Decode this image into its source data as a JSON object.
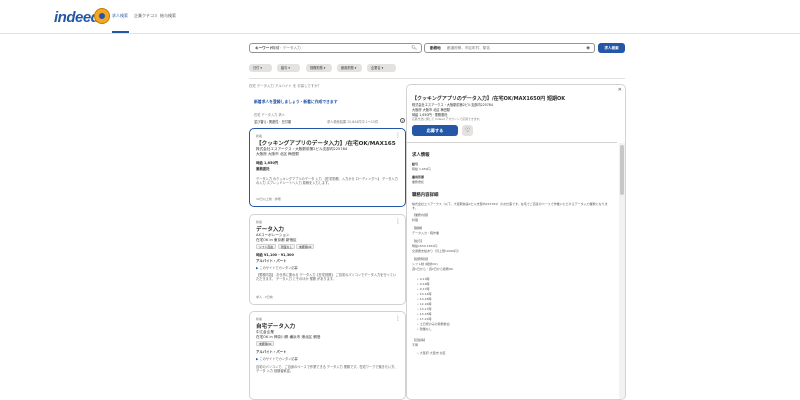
{
  "header": {
    "logo": "indeed",
    "nav": [
      "求人検索",
      "企業クチコミ",
      "給与検索"
    ]
  },
  "search": {
    "what_label": "キーワード",
    "what_placeholder": "職種・データ入力",
    "where_label": "勤務地",
    "where_placeholder": "都道府県、市区町村、駅名",
    "button": "求人検索"
  },
  "filters": [
    "日付",
    "給与",
    "勤務形態",
    "雇用形態",
    "企業名"
  ],
  "results": {
    "prompt": "在宅 データ入力 アルバイト を お探しですか？",
    "alert": "新着求人を登録しましょう・新着に作成できます",
    "meta": "在宅 データ入力 求人",
    "sort": "並び替え: 関連性 · 日付順",
    "count": "求人検索結果 25,844件中 1〜15件"
  },
  "cards": [
    {
      "new": "新着",
      "title": "【クッキングアプリのデータ入力】/在宅OK/MAX1650円 短...",
      "company": "株式会社エスアークス・大阪駅前第2ビル支部内225784",
      "location": "大阪府 大阪市 北区 梅田駅",
      "salary": "時給 1,650円",
      "type": "業務委託",
      "snippet": "データ入力 のクッキングアプリのデータ 入力 【在宅勤務、入力から ローディングへ】 データ入力 の入力 スプレッドシートへ入力 原稿を入力します。",
      "foot": "30日以上前 · 詳細"
    },
    {
      "new": "新着",
      "title": "データ入力",
      "company": "AXコーポレーション",
      "location": "在宅OK in 東京都 新宿区",
      "tags": [
        "シフト自由",
        "残業なし",
        "未経験OK"
      ],
      "salary": "時給 ¥1,100 - ¥1,300",
      "type": "アルバイト・パート",
      "easy": "このサイトでカンタン応募",
      "snippet": "【業務内容】 お仕事に関わる データ入力【在宅勤務】 ご自宅のパソコンでデータ入力を行っていただきます。 データ入力 とそのほか 業務 があります。",
      "foot": "求人 · 2日前"
    },
    {
      "new": "新着",
      "title": "自宅データ入力",
      "company": "中江倉企業",
      "location": "在宅OK in 神奈川県 横浜市 港北区 綱島",
      "tags": [
        "未経験OK"
      ],
      "salary": "",
      "type": "アルバイト・パート",
      "easy": "このサイトでカンタン応募",
      "snippet": "自宅のパソコンで、ご自身のペースで作業できる データ入力 業務です。在宅ワークで働きたい方、データ 入力 経験者歓迎。",
      "foot": ""
    }
  ],
  "detail": {
    "title": "【クッキングアプリのデータ入力】/在宅OK/MAX1650円 短期OK",
    "company": "株式会社エスアークス・大阪駅前第2ビル支部内225784",
    "location": "大阪府 大阪市 北区 梅田駅",
    "salary": "時給 1,650円 · 業務委託",
    "note": "応募方法に関して Indeed アカウントで応募できます。",
    "apply": "応募する",
    "sections": {
      "info_title": "求人情報",
      "pay_label": "給与",
      "pay_value": "時給 1,650円",
      "type_label": "雇用形態",
      "type_value": "業務委託",
      "desc_title": "職務内容詳細",
      "desc_text": "株式会社エスアークス（以下、大阪駅前第2ビル支部内225784）のお仕事です。在宅でご自身のペースで作業いただけるデータ入力業務になります。",
      "block1_label": "【業務内容】",
      "block1_text": "料理",
      "block2_label": "【職種】",
      "block2_text": "データ入力・軽作業",
      "block3_label": "【給与】",
      "block3_text": "時給1650-1650円",
      "block3_text2": "交通費支給あり（月上限10000円）",
      "block4_label": "【勤務時間】",
      "block4_text": "シフト制 (相談OK)",
      "block4_text2": "週1日から・週2日から勤務OK",
      "bullets": [
        "9-13時",
        "9-16時",
        "9-17時",
        "10-14時",
        "10-18時",
        "12-16時",
        "13-17時",
        "13-18時",
        "17-21時",
        "土日祝のみの勤務歓迎",
        "残業なし"
      ],
      "block5_label": "【資格等】",
      "block5_text": "不問",
      "block6_text": "大阪府 大阪市 北区"
    }
  }
}
